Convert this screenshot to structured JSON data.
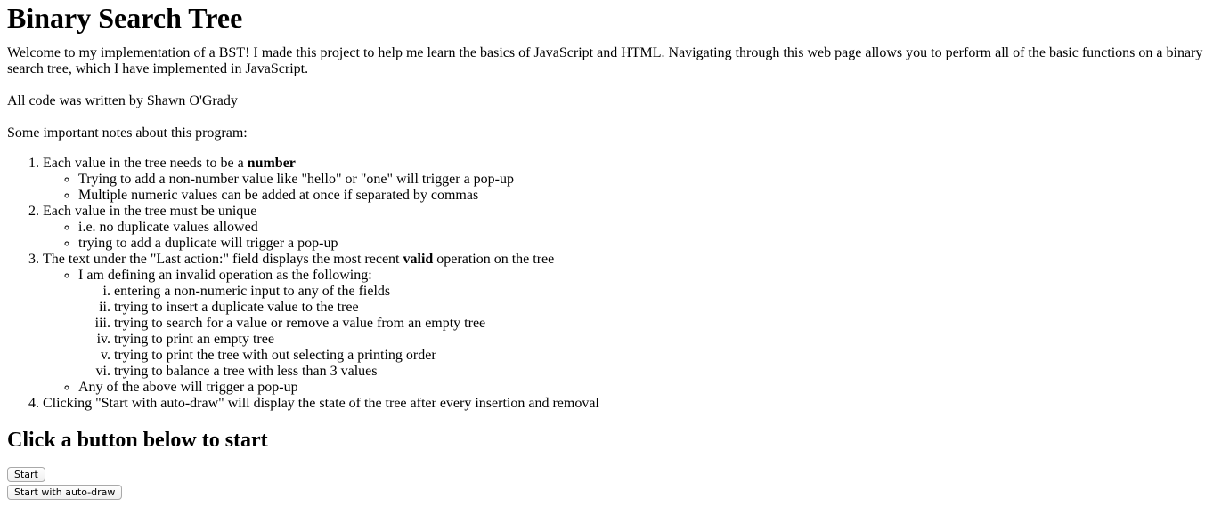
{
  "title": "Binary Search Tree",
  "intro": "Welcome to my implementation of a BST! I made this project to help me learn the basics of JavaScript and HTML. Navigating through this web page allows you to perform all of the basic functions on a binary search tree, which I have implemented in JavaScript.",
  "author": "All code was written by Shawn O'Grady",
  "notes_heading": "Some important notes about this program:",
  "notes": {
    "n1_prefix": "Each value in the tree needs to be a ",
    "n1_bold": "number",
    "n1_sub1": "Trying to add a non-number value like \"hello\" or \"one\" will trigger a pop-up",
    "n1_sub2": "Multiple numeric values can be added at once if separated by commas",
    "n2": "Each value in the tree must be unique",
    "n2_sub1": "i.e. no duplicate values allowed",
    "n2_sub2": "trying to add a duplicate will trigger a pop-up",
    "n3_prefix": "The text under the \"Last action:\" field displays the most recent ",
    "n3_bold": "valid",
    "n3_suffix": " operation on the tree",
    "n3_sub1": "I am defining an invalid operation as the following:",
    "n3_roman": [
      "entering a non-numeric input to any of the fields",
      "trying to insert a duplicate value to the tree",
      "trying to search for a value or remove a value from an empty tree",
      "trying to print an empty tree",
      "trying to print the tree with out selecting a printing order",
      "trying to balance a tree with less than 3 values"
    ],
    "n3_sub2": "Any of the above will trigger a pop-up",
    "n4": "Clicking \"Start with auto-draw\" will display the state of the tree after every insertion and removal"
  },
  "start_heading": "Click a button below to start",
  "buttons": {
    "start": "Start",
    "start_auto": "Start with auto-draw"
  }
}
